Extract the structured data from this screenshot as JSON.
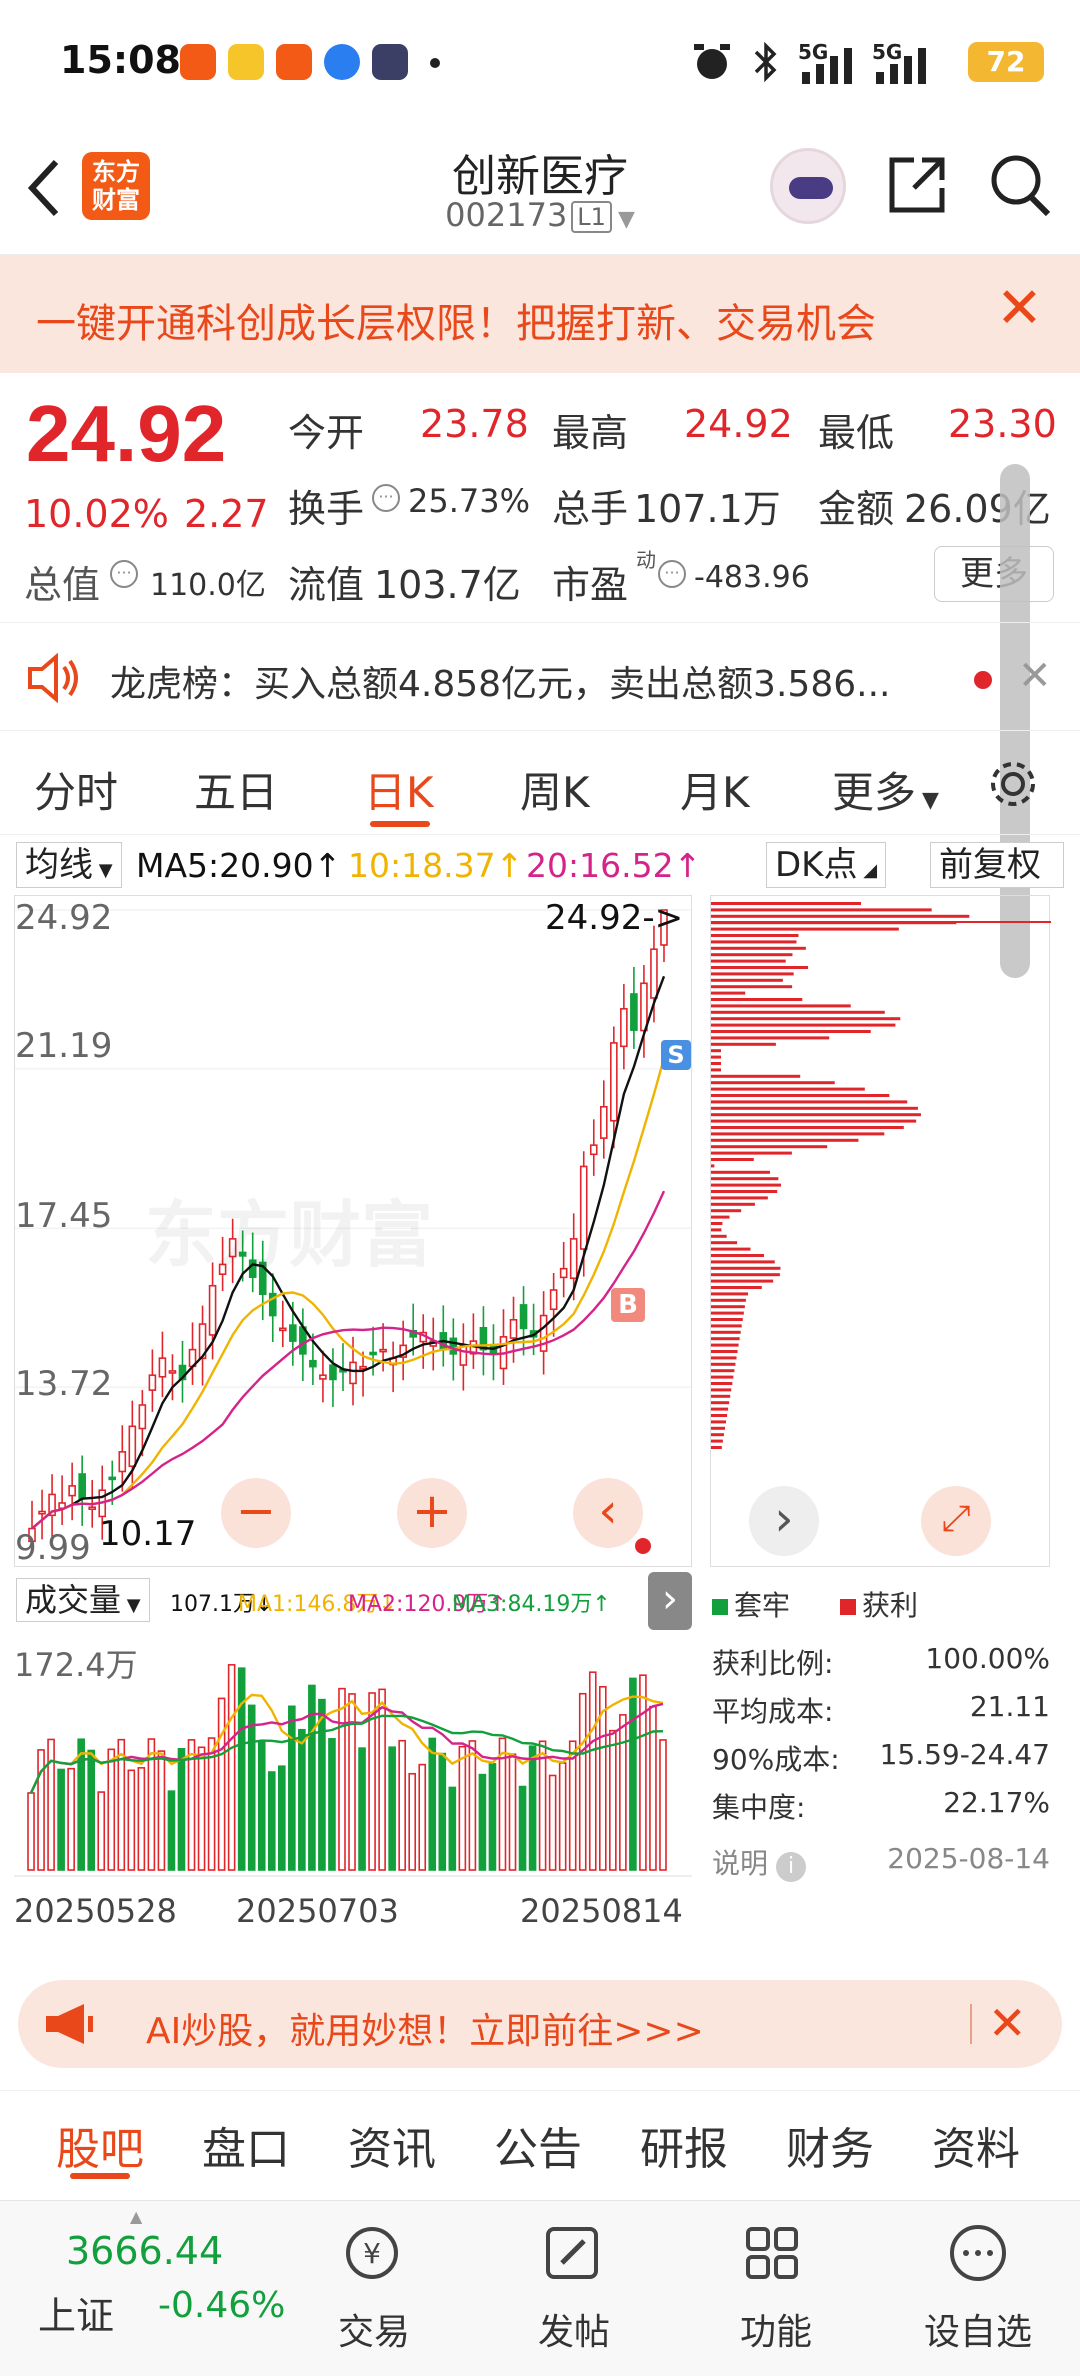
{
  "status_bar": {
    "time": "15:08",
    "battery": "72",
    "network1": "5G",
    "network2": "5G"
  },
  "header": {
    "logo": "东方\n财富",
    "title": "创新医疗",
    "code": "002173",
    "level": "L1"
  },
  "promo": {
    "text": "一键开通科创成长层权限！把握打新、交易机会"
  },
  "quote": {
    "price": "24.92",
    "change_pct": "10.02%",
    "change": "2.27",
    "open_label": "今开",
    "open": "23.78",
    "high_label": "最高",
    "high": "24.92",
    "low_label": "最低",
    "low": "23.30",
    "turnover_label": "换手",
    "turnover": "25.73%",
    "volume_label": "总手",
    "volume": "107.1万",
    "amount_label": "金额",
    "amount": "26.09亿",
    "mcap_label": "总值",
    "mcap": "110.0亿",
    "float_label": "流值",
    "float": "103.7亿",
    "pe_label": "市盈",
    "pe_sup": "动",
    "pe": "-483.96",
    "more": "更多"
  },
  "dragon": {
    "text": "龙虎榜：买入总额4.858亿元，卖出总额3.586..."
  },
  "tabs": [
    "分时",
    "五日",
    "日K",
    "周K",
    "月K",
    "更多"
  ],
  "active_tab": 2,
  "kline": {
    "ma_select": "均线",
    "ma5": "MA5:20.90↑",
    "ma10": "10:18.37↑",
    "ma20": "20:16.52↑",
    "dk": "DK点",
    "fq": "前复权",
    "y_labels": [
      "24.92",
      "21.19",
      "17.45",
      "13.72",
      "9.99"
    ],
    "last_label": "24.92->",
    "low_label": "10.17",
    "watermark": "东方财富",
    "vol_select": "成交量",
    "vol_info": "107.1万↓",
    "vol_ma1": "MA1:146.8万↓",
    "vol_ma2": "MA2:120.9万↑",
    "vol_ma3": "MA3:84.19万↑",
    "vol_max": "172.4万",
    "dates": [
      "20250528",
      "20250703",
      "20250814"
    ],
    "sig_s": "S",
    "sig_b": "B"
  },
  "chip": {
    "legend_trap": "套牢",
    "legend_profit": "获利",
    "rows": [
      {
        "label": "获利比例:",
        "value": "100.00%"
      },
      {
        "label": "平均成本:",
        "value": "21.11"
      },
      {
        "label": "90%成本:",
        "value": "15.59-24.47"
      },
      {
        "label": "集中度:",
        "value": "22.17%"
      }
    ],
    "note": "说明",
    "date": "2025-08-14"
  },
  "ai_bar": {
    "text": "AI炒股，就用妙想！立即前往>>>"
  },
  "bottom_tabs": [
    "股吧",
    "盘口",
    "资讯",
    "公告",
    "研报",
    "财务",
    "资料"
  ],
  "footer": {
    "index_value": "3666.44",
    "index_name": "上证",
    "index_change": "-0.46%",
    "items": [
      "交易",
      "发帖",
      "功能",
      "设自选"
    ]
  },
  "colors": {
    "up": "#e0262b",
    "down": "#12a03c",
    "accent": "#e8481a",
    "ma5": "#111111",
    "ma10": "#f0b400",
    "ma20": "#d4238a"
  }
}
